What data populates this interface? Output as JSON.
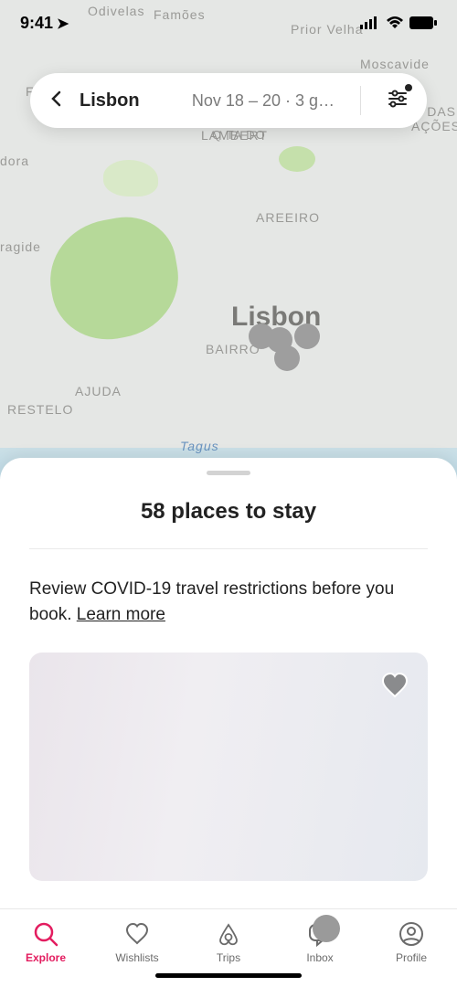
{
  "status": {
    "time": "9:41"
  },
  "search": {
    "location": "Lisbon",
    "details": "Nov 18 – 20 · 3 g…"
  },
  "map_labels": {
    "lisbon": "Lisbon",
    "areeiro": "AREEIRO",
    "ajuda": "AJUDA",
    "restelo": "RESTELO",
    "bairro": "BAIRRO",
    "lambert": "LAMBERT",
    "qtado": "Q.TA DO",
    "odivelas": "Odivelas",
    "prior": "Prior Velha",
    "moscavide": "Moscavide",
    "edas": "E DAS",
    "acoes": "AÇÕES",
    "dora": "dora",
    "ragide": "ragide",
    "tagus": "Tagus",
    "fontinha": "Fontinha",
    "famoes": "Famões"
  },
  "sheet": {
    "title": "58 places to stay",
    "covid_text": "Review COVID-19 travel restrictions before you book. ",
    "covid_link": "Learn more"
  },
  "tabs": {
    "explore": "Explore",
    "wishlists": "Wishlists",
    "trips": "Trips",
    "inbox": "Inbox",
    "profile": "Profile"
  }
}
